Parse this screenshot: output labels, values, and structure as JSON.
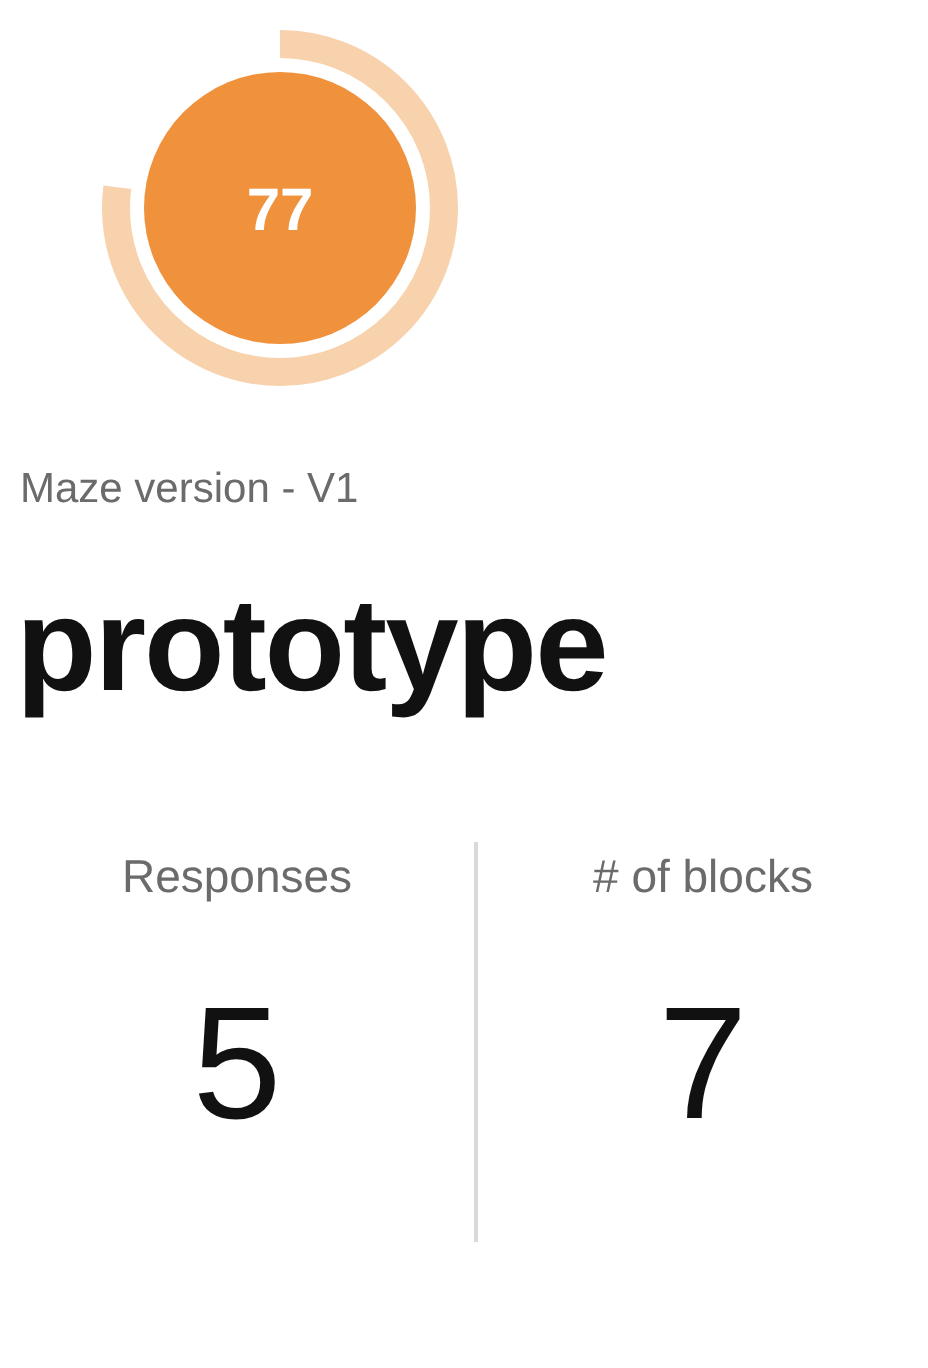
{
  "score": {
    "value": "77",
    "level": 0.77
  },
  "subtitle": "Maze version - V1",
  "title": "prototype",
  "stats": [
    {
      "label": "Responses",
      "value": "5"
    },
    {
      "label": "# of blocks",
      "value": "7"
    }
  ]
}
